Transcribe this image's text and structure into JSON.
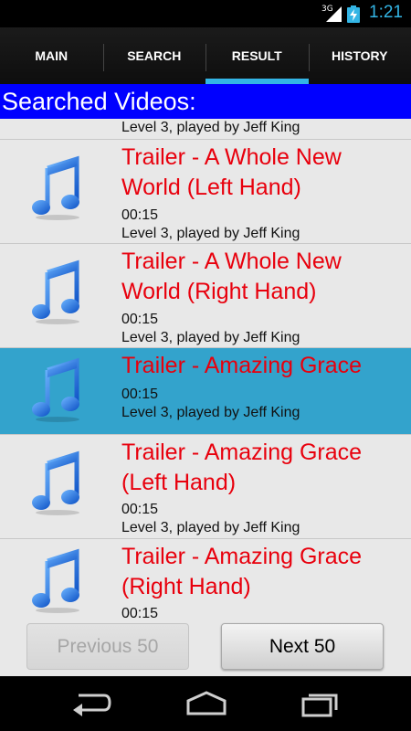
{
  "status_bar": {
    "network": "3G",
    "time": "1:21"
  },
  "tabs": [
    {
      "label": "MAIN",
      "selected": false
    },
    {
      "label": "SEARCH",
      "selected": false
    },
    {
      "label": "RESULT",
      "selected": true
    },
    {
      "label": "HISTORY",
      "selected": false
    }
  ],
  "header": {
    "title": "Searched Videos:"
  },
  "list": {
    "partial_row": {
      "level": "Level 3, played by Jeff King"
    },
    "items": [
      {
        "icon": "music-note-icon",
        "title": "Trailer - A Whole New World (Left Hand)",
        "duration": "00:15",
        "level": "Level 3, played by Jeff King",
        "selected": false
      },
      {
        "icon": "music-note-icon",
        "title": "Trailer - A Whole New World (Right Hand)",
        "duration": "00:15",
        "level": "Level 3, played by Jeff King",
        "selected": false
      },
      {
        "icon": "music-note-icon",
        "title": "Trailer - Amazing Grace",
        "duration": "00:15",
        "level": "Level 3, played by Jeff King",
        "selected": true
      },
      {
        "icon": "music-note-icon",
        "title": "Trailer - Amazing Grace (Left Hand)",
        "duration": "00:15",
        "level": "Level 3, played by Jeff King",
        "selected": false
      },
      {
        "icon": "music-note-icon",
        "title": "Trailer - Amazing Grace (Right Hand)",
        "duration": "00:15",
        "level": "",
        "selected": false
      }
    ]
  },
  "buttons": {
    "previous_label": "Previous 50",
    "previous_enabled": false,
    "next_label": "Next 50"
  },
  "colors": {
    "accent": "#33b5e5",
    "header_bg": "#0000ff",
    "title_text": "#e8000d",
    "selected_row": "#33a3cc"
  }
}
